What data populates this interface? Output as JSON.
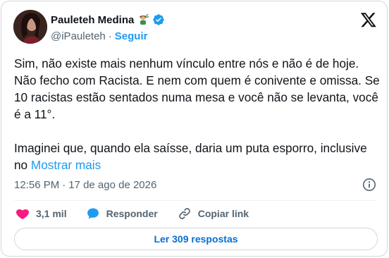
{
  "author": {
    "display_name": "Pauleteh Medina",
    "handle": "@iPauleteh",
    "follow_label": "Seguir",
    "emoji_icon": "woman-farmer-emoji",
    "verified_icon": "verified-badge-icon",
    "verified_color": "#1d9bf0"
  },
  "tweet": {
    "text": "Sim, não existe mais nenhum vínculo entre nós e não é de hoje. Não fecho com Racista. E nem com quem é conivente e omissa. Se 10 racistas estão sentados numa mesa e você não se levanta, você é a 11°.\n\nImaginei que, quando ela saísse, daria um puta esporro, inclusive no ",
    "show_more_label": "Mostrar mais"
  },
  "meta": {
    "time": "12:56 PM",
    "separator": "·",
    "date": "17 de ago de 2026"
  },
  "actions": {
    "like_count": "3,1 mil",
    "reply_label": "Responder",
    "copy_link_label": "Copiar link",
    "like_color": "#f91880",
    "reply_color": "#1d9bf0"
  },
  "footer": {
    "read_replies_label": "Ler 309 respostas"
  },
  "colors": {
    "accent": "#1d9bf0",
    "text_primary": "#0f1419",
    "text_secondary": "#536471"
  }
}
